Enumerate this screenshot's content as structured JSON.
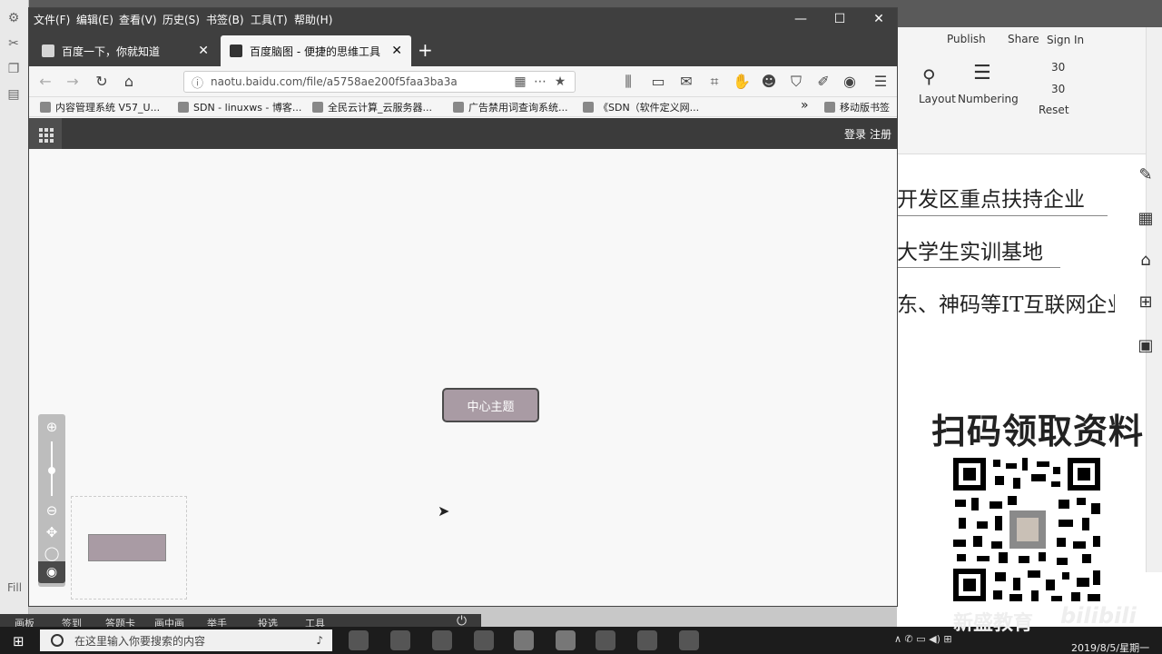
{
  "browser": {
    "menus": [
      "文件(F)",
      "编辑(E)",
      "查看(V)",
      "历史(S)",
      "书签(B)",
      "工具(T)",
      "帮助(H)"
    ],
    "tabs": [
      {
        "title": "百度一下，你就知道",
        "active": false
      },
      {
        "title": "百度脑图 - 便捷的思维工具",
        "active": true
      }
    ],
    "new_tab": "+",
    "url": "naotu.baidu.com/file/a5758ae200f5faa3ba3a",
    "bookmarks": [
      "内容管理系统 V57_U...",
      "SDN - linuxws - 博客...",
      "全民云计算_云服务器...",
      "广告禁用词查询系统...",
      "《SDN（软件定义网...",
      "移动版书签"
    ],
    "bookmarks_more": "»"
  },
  "site": {
    "login": "登录",
    "register": "注册"
  },
  "mindmap": {
    "center_topic": "中心主题",
    "zoom_in": "⊕",
    "zoom_out": "⊖",
    "move": "✥",
    "fit": "◯",
    "eye": "◉"
  },
  "background_app": {
    "toolbar": {
      "publish": "Publish",
      "share": "Share",
      "sign_in": "Sign In",
      "layout": "Layout",
      "numbering": "Numbering",
      "reset": "Reset",
      "value1": "30",
      "value2": "30"
    },
    "doc_lines": [
      "开发区重点扶持企业",
      "大学生实训基地",
      "东、神码等IT互联网企业"
    ],
    "qr_title": "扫码领取资料",
    "fill_label": "Fill"
  },
  "recording_bar": [
    "画板",
    "签到",
    "答题卡",
    "画中画",
    "举手",
    "投选",
    "工具"
  ],
  "taskbar": {
    "search_placeholder": "在这里输入你要搜索的内容",
    "clock": "2019/8/5/星期一",
    "watermark": "新盛教育",
    "watermark2": "bilibili"
  },
  "colors": {
    "topic_fill": "#a99ba4",
    "header_dark": "#3b3b3b",
    "menubar": "#3f3f3f"
  }
}
